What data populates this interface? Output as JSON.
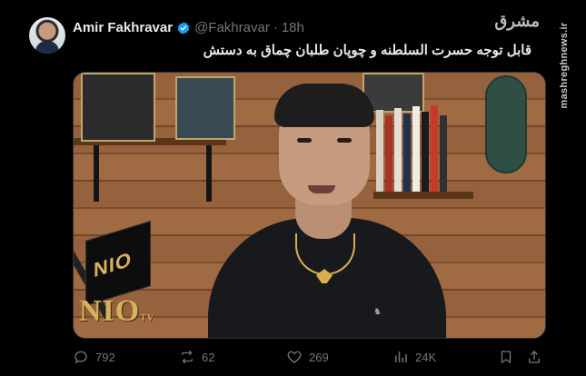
{
  "tweet": {
    "author_name": "Amir Fakhravar",
    "handle": "@Fakhravar",
    "separator": "·",
    "time": "18h",
    "text": "قابل توجه حسرت السلطنه و چوپان طلبان چماق به دستش"
  },
  "watermark": {
    "logo": "مشرق",
    "site": "mashreghnews.ir"
  },
  "video_overlay": {
    "mic_logo": "NIO",
    "brand_logo": "NIO",
    "brand_suffix": "TV"
  },
  "actions": {
    "replies": "792",
    "reposts": "62",
    "likes": "269",
    "views": "24K"
  },
  "icons": {
    "verified": "verified-badge-icon",
    "reply": "reply-icon",
    "repost": "repost-icon",
    "like": "heart-icon",
    "views": "views-icon",
    "bookmark": "bookmark-icon",
    "share": "share-icon"
  },
  "colors": {
    "background": "#000000",
    "primary_text": "#e7e9ea",
    "secondary_text": "#71767b",
    "verified": "#1d9bf0"
  }
}
